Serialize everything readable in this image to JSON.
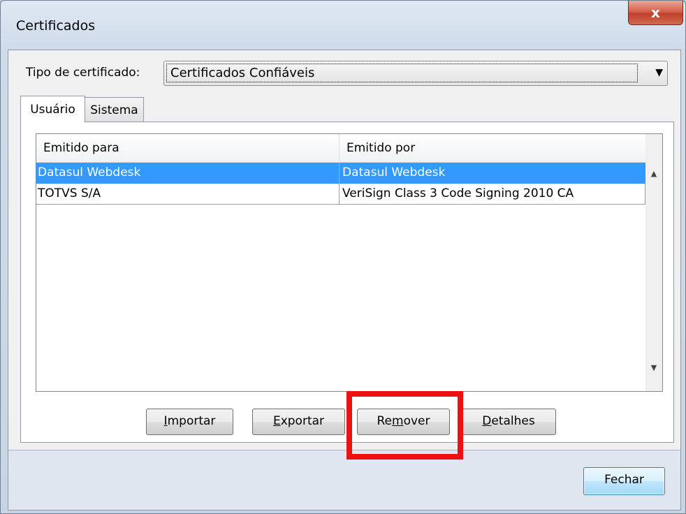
{
  "window": {
    "title": "Certificados",
    "close_symbol": "x"
  },
  "tipo": {
    "label": "Tipo de certificado:",
    "selected": "Certificados Confiáveis"
  },
  "tabs": [
    {
      "label": "Usuário",
      "active": true
    },
    {
      "label": "Sistema",
      "active": false
    }
  ],
  "list": {
    "columns": [
      "Emitido para",
      "Emitido por"
    ],
    "rows": [
      {
        "para": "Datasul Webdesk",
        "por": "Datasul Webdesk",
        "selected": true
      },
      {
        "para": "TOTVS S/A",
        "por": "VeriSign Class 3 Code Signing 2010 CA",
        "selected": false
      }
    ]
  },
  "buttons": {
    "importar": {
      "mnemonic": "I",
      "rest": "mportar"
    },
    "exportar": {
      "mnemonic": "E",
      "rest": "xportar"
    },
    "remover": {
      "pre": "Re",
      "mnemonic": "m",
      "rest": "over"
    },
    "detalhes": {
      "mnemonic": "D",
      "rest": "etalhes"
    },
    "fechar": "Fechar"
  },
  "colors": {
    "selection": "#3399ff",
    "highlight_box": "#ee1111"
  }
}
